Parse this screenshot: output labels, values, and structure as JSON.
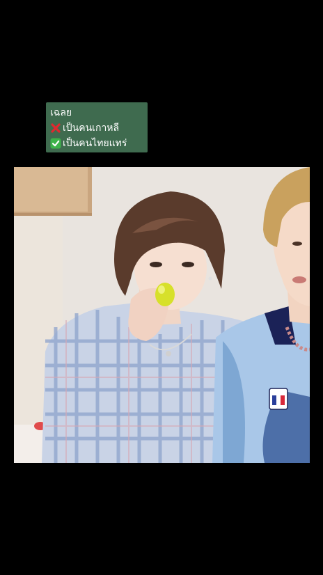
{
  "caption": {
    "title": "เฉลย",
    "wrong_text": "เป็นคนเกาหลี",
    "wrong_icon": "cross-mark-icon",
    "correct_text": "เป็นคนไทยแทร่",
    "correct_icon": "check-mark-icon",
    "box_color": "#3f6b4f"
  },
  "photo": {
    "subject_left": "person in blue plaid shirt drinking from small yellow bottle",
    "subject_right": "blond person in blue and white jersey"
  }
}
